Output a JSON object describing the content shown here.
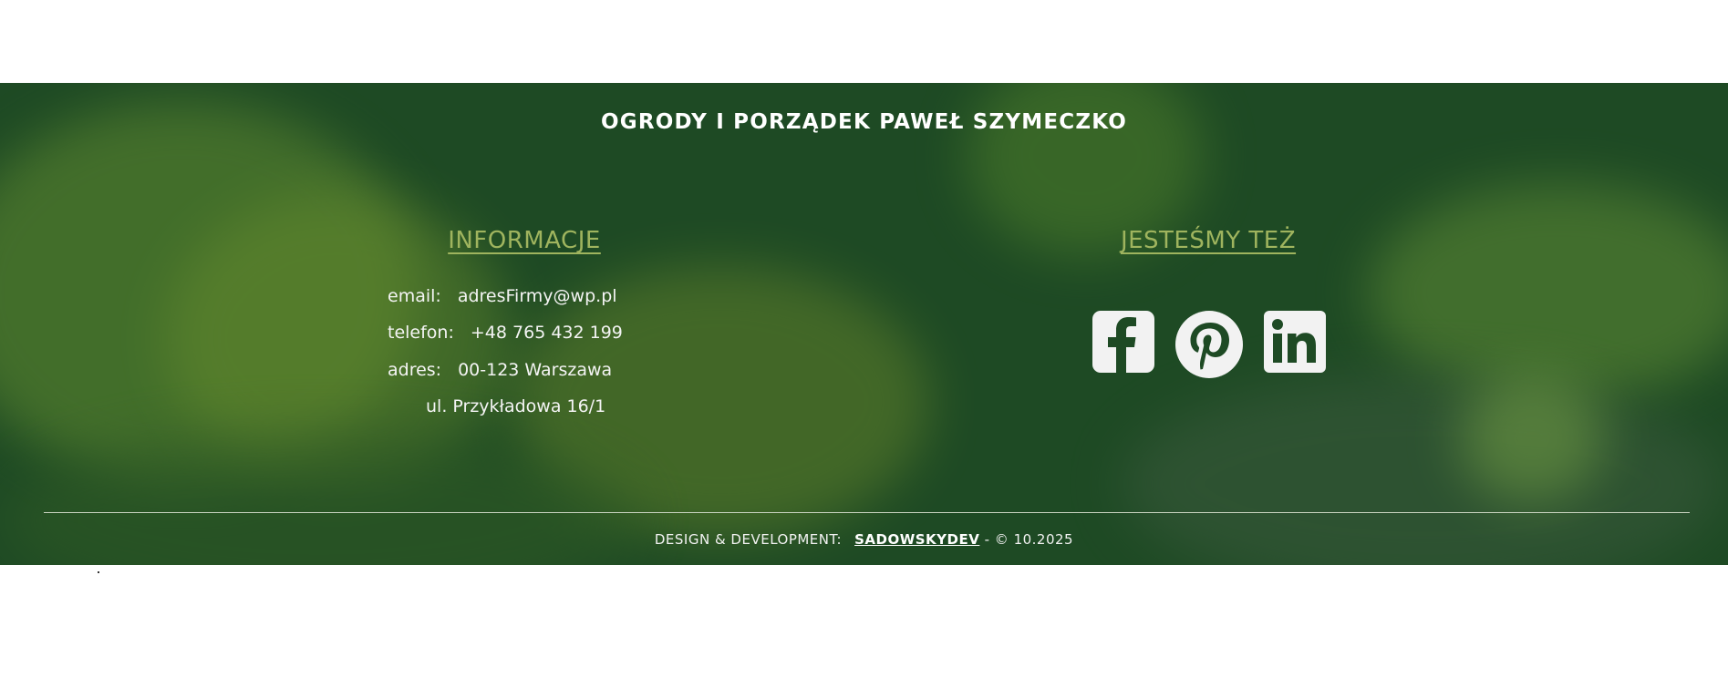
{
  "footer": {
    "brand": "OGRODY I PORZĄDEK PAWEŁ SZYMECZKO",
    "info": {
      "heading": "INFORMACJE",
      "email_label": "email:",
      "email_value": "adresFirmy@wp.pl",
      "phone_label": "telefon:",
      "phone_value": "+48 765 432 199",
      "address_label": "adres:",
      "address_value": "00-123 Warszawa",
      "street": "ul. Przykładowa 16/1"
    },
    "social": {
      "heading": "JESTEŚMY TEŻ",
      "icons": [
        "facebook-icon",
        "pinterest-icon",
        "linkedin-icon"
      ]
    },
    "credits": {
      "label": "DESIGN & DEVELOPMENT:",
      "author": "SADOWSKYDEV",
      "suffix": "- © 10.2025"
    }
  },
  "colors": {
    "footer_bg": "#1e4a24",
    "heading_accent": "#9fb45e",
    "icon_fill": "#f2f2f2"
  }
}
